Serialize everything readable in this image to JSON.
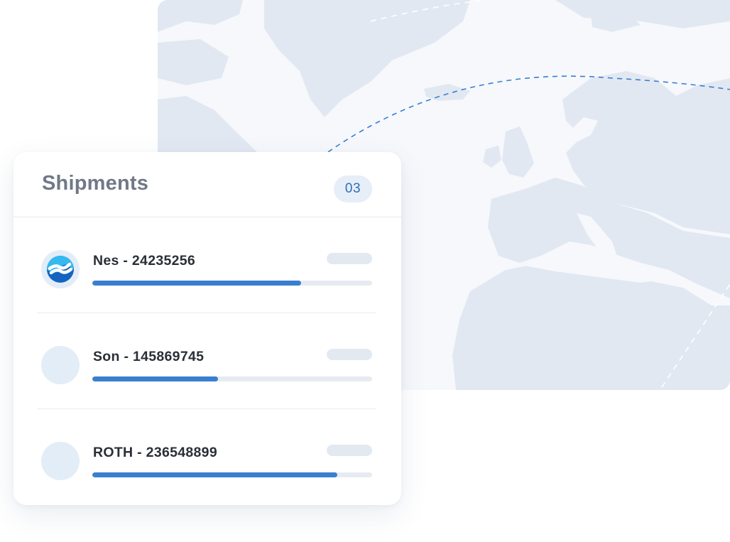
{
  "card": {
    "title": "Shipments",
    "count": "03"
  },
  "shipments": [
    {
      "label": "Nes - 24235256",
      "progress": 0.745,
      "logo": "nes-logo"
    },
    {
      "label": "Son - 145869745",
      "progress": 0.45,
      "logo": ""
    },
    {
      "label": "ROTH - 236548899",
      "progress": 0.875,
      "logo": ""
    }
  ],
  "colors": {
    "accent": "#3a7fcf",
    "map_land": "#e2e8f2",
    "map_background": "#f6f8fc",
    "route": "#3a7fcf"
  }
}
